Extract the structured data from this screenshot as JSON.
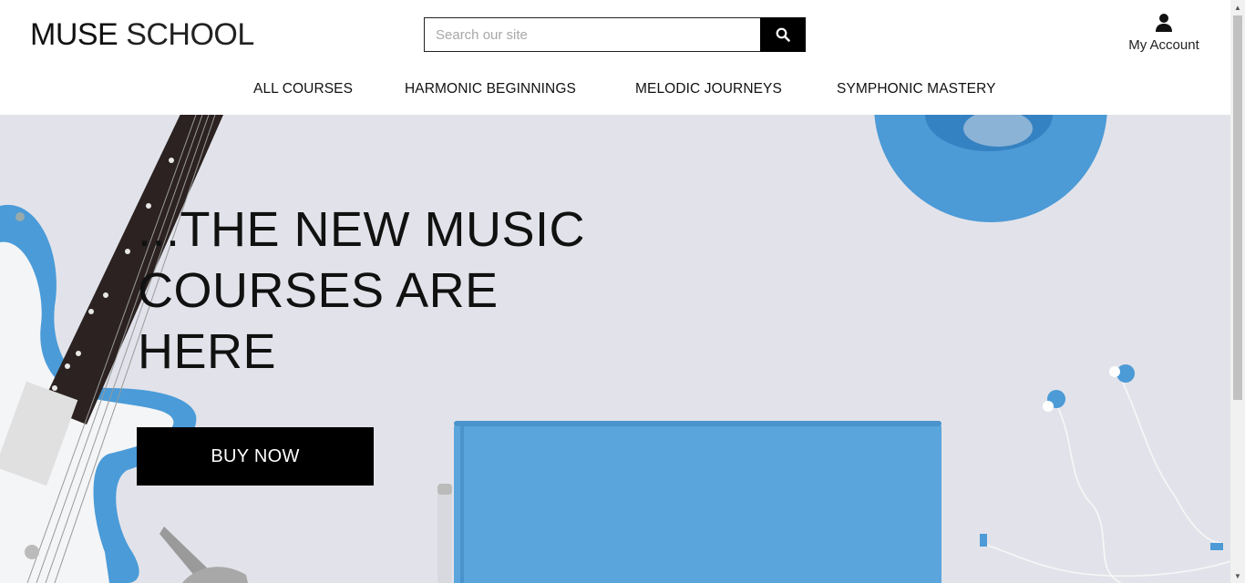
{
  "header": {
    "logo_bold": "MUSE",
    "logo_light": "SCHOOL",
    "search_placeholder": "Search our site",
    "account_label": "My Account"
  },
  "nav": {
    "items": [
      {
        "label": "ALL COURSES"
      },
      {
        "label": "HARMONIC BEGINNINGS"
      },
      {
        "label": "MELODIC JOURNEYS"
      },
      {
        "label": "SYMPHONIC MASTERY"
      }
    ]
  },
  "hero": {
    "headline": "...THE NEW MUSIC COURSES ARE HERE",
    "cta_label": "BUY NOW"
  },
  "colors": {
    "hero_background": "#e2e3ea",
    "accent_blue": "#4c9ad6",
    "button_black": "#000000"
  }
}
